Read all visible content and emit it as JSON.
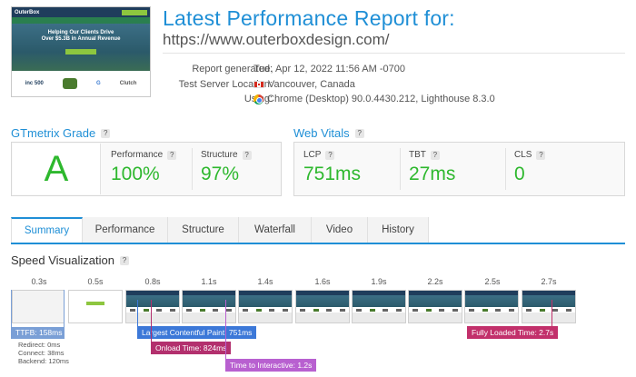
{
  "report": {
    "title": "Latest Performance Report for:",
    "url": "https://www.outerboxdesign.com/"
  },
  "thumbnail": {
    "logo_text": "OuterBox",
    "hero_title_line1": "Helping Our Clients Drive",
    "hero_title_line2": "Over $5.3B in Annual Revenue",
    "partner_logos": [
      "inc 500",
      "G",
      "Clutch"
    ]
  },
  "meta": {
    "generated_label": "Report generated:",
    "generated_value": "Tue, Apr 12, 2022 11:56 AM -0700",
    "location_label": "Test Server Location:",
    "location_value": "Vancouver, Canada",
    "using_label": "Using:",
    "using_value": "Chrome (Desktop) 90.0.4430.212, Lighthouse 8.3.0"
  },
  "gtmetrix": {
    "title": "GTmetrix Grade",
    "grade": "A",
    "performance_label": "Performance",
    "performance_value": "100%",
    "structure_label": "Structure",
    "structure_value": "97%"
  },
  "web_vitals": {
    "title": "Web Vitals",
    "lcp_label": "LCP",
    "lcp_value": "751ms",
    "tbt_label": "TBT",
    "tbt_value": "27ms",
    "cls_label": "CLS",
    "cls_value": "0"
  },
  "tabs": [
    {
      "label": "Summary",
      "active": true
    },
    {
      "label": "Performance",
      "active": false
    },
    {
      "label": "Structure",
      "active": false
    },
    {
      "label": "Waterfall",
      "active": false
    },
    {
      "label": "Video",
      "active": false
    },
    {
      "label": "History",
      "active": false
    }
  ],
  "speed_viz": {
    "title": "Speed Visualization",
    "ticks": [
      "0.3s",
      "0.5s",
      "0.8s",
      "1.1s",
      "1.4s",
      "1.6s",
      "1.9s",
      "2.2s",
      "2.5s",
      "2.7s"
    ],
    "ttfb": {
      "label": "TTFB: 158ms",
      "redirect": "Redirect: 0ms",
      "connect": "Connect: 38ms",
      "backend": "Backend: 120ms"
    },
    "markers": {
      "lcp": "Largest Contentful Paint: 751ms",
      "onload": "Onload Time: 824ms",
      "tti": "Time to Interactive: 1.2s",
      "fully_loaded": "Fully Loaded Time: 2.7s"
    }
  },
  "colors": {
    "accent": "#1f8fd6",
    "grade_green": "#2eb82e",
    "ttfb": "#7a9fd6",
    "lcp": "#3c78d8",
    "onload": "#b3306e",
    "tti": "#b860d0",
    "fully_loaded": "#c2306b"
  }
}
